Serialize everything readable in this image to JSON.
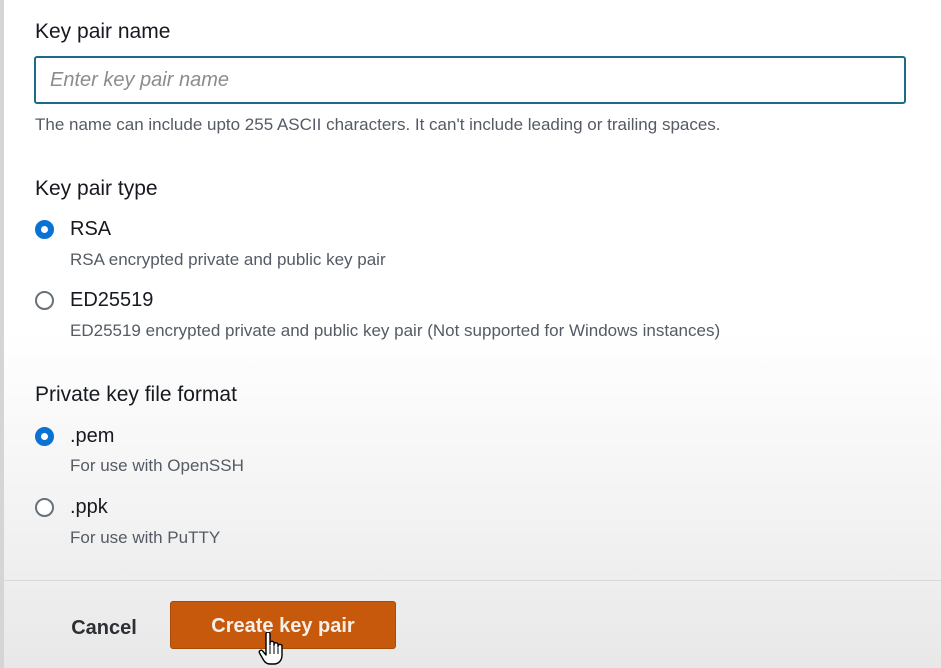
{
  "key_pair_name": {
    "label": "Key pair name",
    "placeholder": "Enter key pair name",
    "value": "",
    "hint": "The name can include upto 255 ASCII characters. It can't include leading or trailing spaces."
  },
  "key_pair_type": {
    "label": "Key pair type",
    "options": [
      {
        "label": "RSA",
        "description": "RSA encrypted private and public key pair",
        "selected": true
      },
      {
        "label": "ED25519",
        "description": "ED25519 encrypted private and public key pair (Not supported for Windows instances)",
        "selected": false
      }
    ]
  },
  "private_key_format": {
    "label": "Private key file format",
    "options": [
      {
        "label": ".pem",
        "description": "For use with OpenSSH",
        "selected": true
      },
      {
        "label": ".ppk",
        "description": "For use with PuTTY",
        "selected": false
      }
    ]
  },
  "footer": {
    "cancel_label": "Cancel",
    "create_label": "Create key pair"
  },
  "colors": {
    "accent": "#0972d3",
    "primary_button": "#c7590c",
    "input_focus_border": "#1b6b8a"
  },
  "icons": {
    "cursor": "hand-pointer-cursor-icon"
  }
}
